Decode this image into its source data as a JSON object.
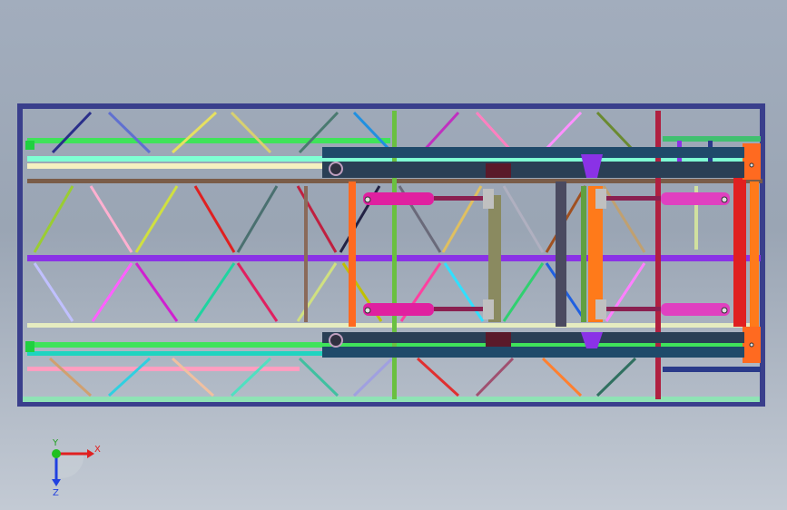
{
  "viewport": {
    "background_top": "#a2adbd",
    "background_bottom": "#c3cad4"
  },
  "model": {
    "frame_color": "#3a3f8c",
    "member_colors": [
      "#3a3f8c",
      "#7b3fd6",
      "#8fe3b5",
      "#ff5f9e",
      "#1f6f8f",
      "#e23b3b",
      "#ff7a1a",
      "#9acd32",
      "#e6e6a0",
      "#2a2f5a",
      "#c2185b",
      "#50e3ff"
    ]
  },
  "triad": {
    "x_label": "X",
    "y_label": "Y",
    "z_label": "Z",
    "x_color": "#e02020",
    "y_color": "#20c020",
    "z_color": "#2040e0"
  }
}
